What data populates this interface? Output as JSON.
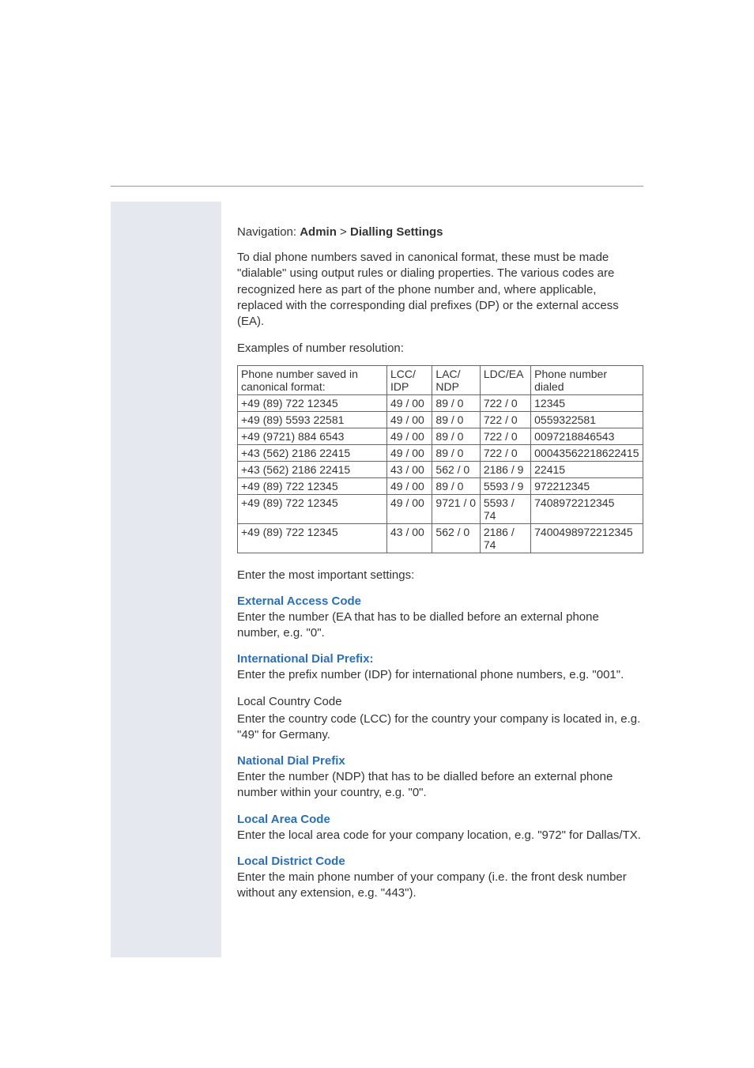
{
  "nav": {
    "prefix": "Navigation: ",
    "admin": "Admin",
    "sep": " > ",
    "page": "Dialling Settings"
  },
  "intro": "To dial phone numbers saved in canonical format, these must be made \"dialable\" using output rules or dialing properties. The various codes are recognized here as part of the phone number and, where applicable, replaced with the corresponding dial prefixes (DP) or the external access (EA).",
  "examples_lead": "Examples of number resolution:",
  "table": {
    "headers": {
      "c1": "Phone number saved in canonical format:",
      "c2": "LCC/ IDP",
      "c3": "LAC/ NDP",
      "c4": "LDC/EA",
      "c5": "Phone number dialed"
    },
    "rows": [
      {
        "c1": "+49 (89) 722 12345",
        "c2": "49 / 00",
        "c3": "89 / 0",
        "c4": "722 / 0",
        "c5": "12345"
      },
      {
        "c1": "+49 (89) 5593 22581",
        "c2": "49 / 00",
        "c3": "89 / 0",
        "c4": "722 / 0",
        "c5": "0559322581"
      },
      {
        "c1": "+49 (9721) 884 6543",
        "c2": "49 / 00",
        "c3": "89 / 0",
        "c4": "722 / 0",
        "c5": "0097218846543"
      },
      {
        "c1": "+43 (562) 2186 22415",
        "c2": "49 / 00",
        "c3": "89 / 0",
        "c4": "722 / 0",
        "c5": "00043562218622415"
      },
      {
        "c1": "+43 (562) 2186 22415",
        "c2": "43 / 00",
        "c3": "562 / 0",
        "c4": "2186 / 9",
        "c5": "22415"
      },
      {
        "c1": "+49 (89) 722 12345",
        "c2": "49 / 00",
        "c3": "89 / 0",
        "c4": "5593 / 9",
        "c5": "972212345"
      },
      {
        "c1": "+49 (89) 722 12345",
        "c2": "49 / 00",
        "c3": "9721 / 0",
        "c4": "5593 / 74",
        "c5": "7408972212345"
      },
      {
        "c1": "+49 (89) 722 12345",
        "c2": "43 / 00",
        "c3": "562 / 0",
        "c4": "2186 / 74",
        "c5": "7400498972212345"
      }
    ]
  },
  "settings_lead": "Enter the most important settings:",
  "sections": {
    "eac": {
      "title": "External Access Code",
      "body": "Enter the number (EA that has to be dialled before an external phone number, e.g. \"0\"."
    },
    "idp": {
      "title": "International Dial Prefix:",
      "body": "Enter the prefix number (IDP) for international phone numbers, e.g. \"001\"."
    },
    "lcc": {
      "title": "Local Country Code",
      "body": "Enter the country code (LCC) for the country your company is located in, e.g. \"49\" for Germany."
    },
    "ndp": {
      "title": "National Dial Prefix",
      "body": "Enter the number (NDP) that has to be dialled before an external phone number within your country, e.g. \"0\"."
    },
    "lac": {
      "title": "Local Area Code",
      "body": "Enter the local area code for your company location, e.g. \"972\" for Dallas/TX."
    },
    "ldc": {
      "title": "Local District Code",
      "body": "Enter the main phone number of your company (i.e. the front desk number without any extension, e.g. \"443\")."
    }
  }
}
